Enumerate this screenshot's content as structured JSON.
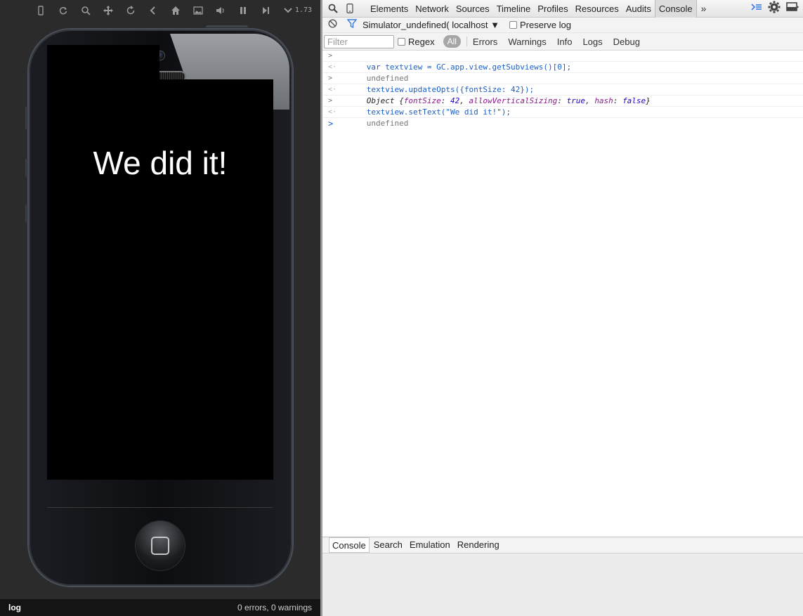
{
  "simulator": {
    "zoom": "1.73",
    "toolbar_icons": [
      "phone-icon",
      "refresh-icon",
      "search-icon",
      "move-icon",
      "rotate-icon",
      "back-icon",
      "home-icon",
      "image-icon",
      "volume-icon",
      "pause-icon",
      "step-icon",
      "dropdown-icon"
    ],
    "screen_text": "We did it!",
    "status_log": "log",
    "status_errors": "0 errors, 0 warnings"
  },
  "devtools": {
    "tabs": [
      "Elements",
      "Network",
      "Sources",
      "Timeline",
      "Profiles",
      "Resources",
      "Audits",
      "Console"
    ],
    "active_tab": "Console",
    "more": "»",
    "context": "Simulator_undefined( localhost ▼",
    "preserve_log": "Preserve log",
    "filter_placeholder": "Filter",
    "regex": "Regex",
    "levels": {
      "all": "All",
      "errors": "Errors",
      "warnings": "Warnings",
      "info": "Info",
      "logs": "Logs",
      "debug": "Debug"
    },
    "console": {
      "line1": "var textview = GC.app.view.getSubviews()[0];",
      "line2": "undefined",
      "line3": "textview.updateOpts({fontSize: 42});",
      "line4": {
        "prefix": "Object {",
        "k1": "fontSize",
        "v1": "42",
        "k2": "allowVerticalSizing",
        "v2": "true",
        "k3": "hash",
        "v3": "false",
        "suffix": "}"
      },
      "line5": "textview.setText(\"We did it!\");",
      "line6": "undefined"
    },
    "drawer_tabs": [
      "Console",
      "Search",
      "Emulation",
      "Rendering"
    ]
  }
}
